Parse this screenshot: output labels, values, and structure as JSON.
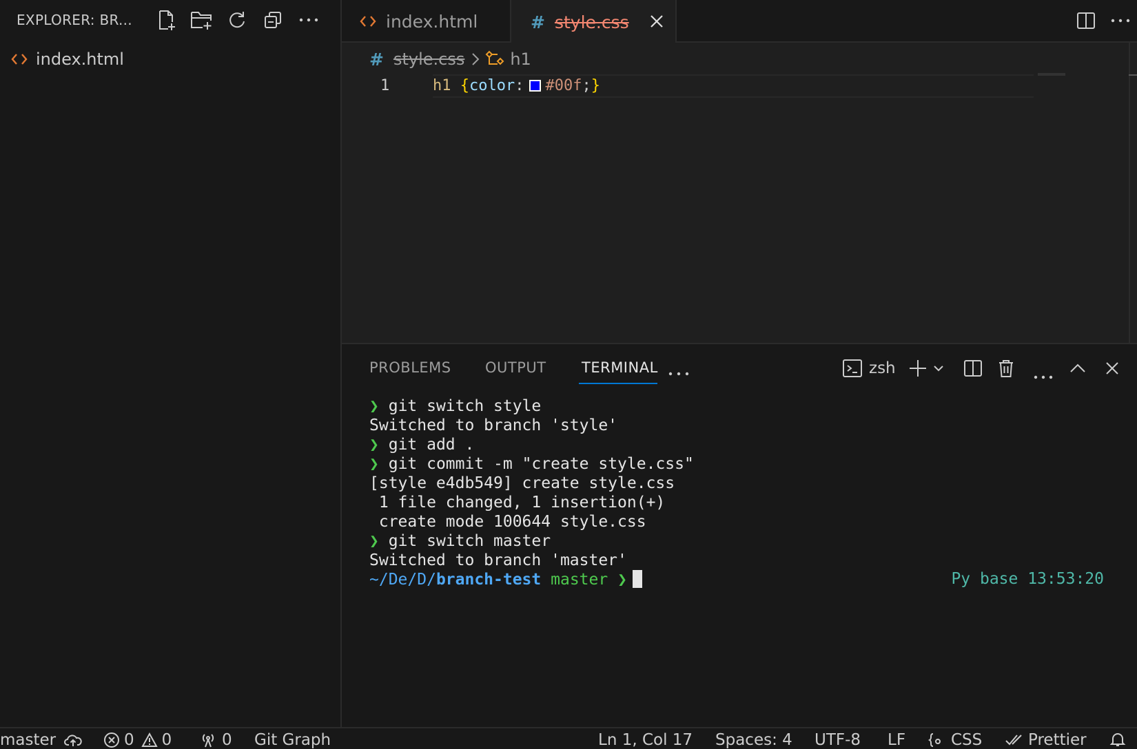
{
  "sidebar": {
    "title": "EXPLORER: BR...",
    "actions": [
      "new-file",
      "new-folder",
      "refresh",
      "collapse-all",
      "more"
    ],
    "files": [
      {
        "name": "index.html",
        "icon": "html-icon"
      }
    ]
  },
  "tabs": {
    "index": {
      "label": "index.html"
    },
    "style": {
      "label": "style.css"
    }
  },
  "breadcrumb": {
    "file": "style.css",
    "symbol": "h1"
  },
  "editor": {
    "line_number": "1",
    "tokens": {
      "selector": "h1",
      "open": "{",
      "property": "color",
      "colon": ":",
      "value": "#00f",
      "semi": ";",
      "close": "}"
    },
    "swatch_color": "#0000ff"
  },
  "panel": {
    "tabs": [
      "PROBLEMS",
      "OUTPUT",
      "TERMINAL"
    ],
    "active_tab": "TERMINAL",
    "shell": "zsh",
    "terminal": {
      "prompt": "❯",
      "lines": [
        {
          "type": "cmd",
          "text": "git switch style"
        },
        {
          "type": "out",
          "text": "Switched to branch 'style'"
        },
        {
          "type": "cmd",
          "text": "git add ."
        },
        {
          "type": "cmd",
          "text": "git commit -m \"create style.css\""
        },
        {
          "type": "out",
          "text": "[style e4db549] create style.css"
        },
        {
          "type": "out",
          "text": " 1 file changed, 1 insertion(+)"
        },
        {
          "type": "out",
          "text": " create mode 100644 style.css"
        },
        {
          "type": "cmd",
          "text": "git switch master"
        },
        {
          "type": "out",
          "text": "Switched to branch 'master'"
        }
      ],
      "path_prefix": "~/De/D/",
      "path_dir": "branch-test",
      "branch": "master",
      "right_status": "Py base 13:53:20"
    }
  },
  "statusbar": {
    "branch": "master",
    "errors": "0",
    "warnings": "0",
    "ports": "0",
    "git_graph": "Git Graph",
    "position": "Ln 1, Col 17",
    "spaces": "Spaces: 4",
    "encoding": "UTF-8",
    "eol": "LF",
    "language": "CSS",
    "formatter": "Prettier"
  }
}
